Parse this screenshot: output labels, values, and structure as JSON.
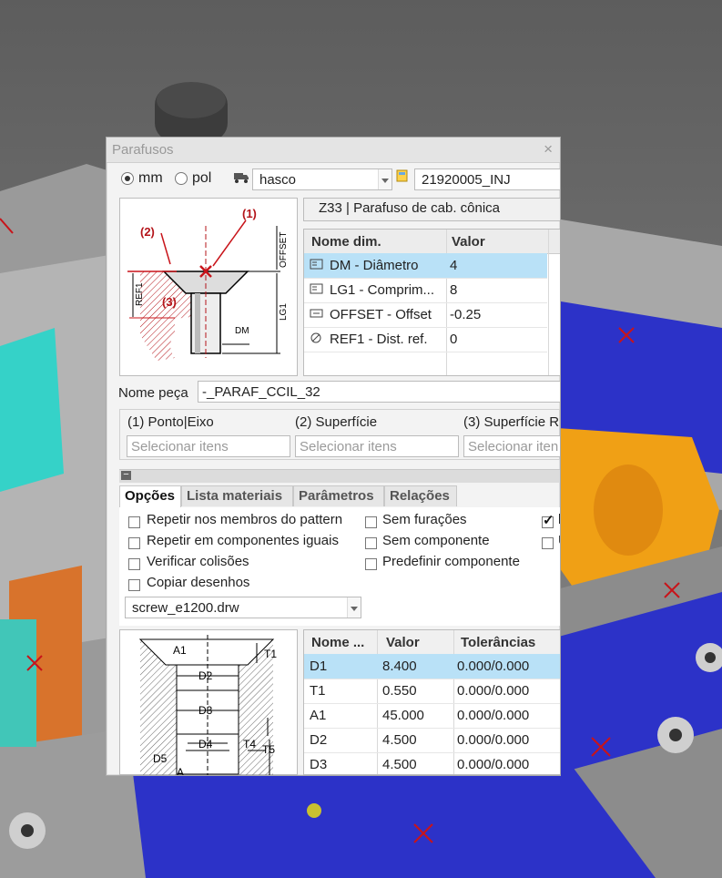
{
  "dialog": {
    "title": "Parafusos",
    "close_glyph": "×",
    "units": {
      "mm_label": "mm",
      "pol_label": "pol",
      "selected": "mm"
    },
    "supplier": {
      "value": "hasco",
      "icon": "truck-icon"
    },
    "catalog": {
      "value": "21920005_INJ",
      "icon": "catalog-icon"
    },
    "screw_type": "Z33 | Parafuso de cab. cônica",
    "top_diagram": {
      "labels": {
        "marker1": "(1)",
        "marker2": "(2)",
        "marker3": "(3)",
        "offset": "OFFSET",
        "ref1": "REF1",
        "lg1": "LG1",
        "dm": "DM"
      }
    },
    "dim_table": {
      "headers": [
        "Nome dim.",
        "Valor"
      ],
      "rows": [
        {
          "icon": "dimension-icon",
          "name": "DM - Diâmetro",
          "value": "4",
          "selected": true
        },
        {
          "icon": "dimension-icon",
          "name": "LG1 - Comprim...",
          "value": "8"
        },
        {
          "icon": "offset-icon",
          "name": "OFFSET - Offset",
          "value": "-0.25"
        },
        {
          "icon": "ref-null-icon",
          "name": "REF1 - Dist. ref.",
          "value": "0"
        }
      ]
    },
    "part_name": {
      "label": "Nome peça",
      "value": "-_PARAF_CCIL_32"
    },
    "references": [
      {
        "label": "(1) Ponto|Eixo",
        "placeholder": "Selecionar itens"
      },
      {
        "label": "(2) Superfície",
        "placeholder": "Selecionar itens"
      },
      {
        "label": "(3) Superfície R",
        "placeholder": "Selecionar iten"
      }
    ],
    "collapse_glyph": "−",
    "tabs": [
      "Opções",
      "Lista materiais",
      "Parâmetros",
      "Relações"
    ],
    "active_tab": "Opções",
    "options": {
      "col1": [
        {
          "label": "Repetir nos membros do pattern",
          "checked": false
        },
        {
          "label": "Repetir em componentes iguais",
          "checked": false
        },
        {
          "label": "Verificar colisões",
          "checked": false
        },
        {
          "label": "Copiar desenhos",
          "checked": false
        }
      ],
      "col2": [
        {
          "label": "Sem furações",
          "checked": false
        },
        {
          "label": "Sem componente",
          "checked": false
        },
        {
          "label": "Predefinir componente",
          "checked": false
        }
      ],
      "col3": [
        {
          "label": "l",
          "checked": true
        },
        {
          "label": "U",
          "checked": false
        }
      ]
    },
    "drawing": {
      "value": "screw_e1200.drw"
    },
    "bottom_diagram": {
      "labels": {
        "a1": "A1",
        "t1": "T1",
        "d2": "D2",
        "d3": "D3",
        "d4": "D4",
        "t4": "T4",
        "t5": "T5",
        "d5": "D5",
        "a": "A"
      }
    },
    "hole_table": {
      "headers": [
        "Nome ...",
        "Valor",
        "Tolerâncias"
      ],
      "rows": [
        {
          "name": "D1",
          "value": "8.400",
          "tol": "0.000/0.000",
          "selected": true
        },
        {
          "name": "T1",
          "value": "0.550",
          "tol": "0.000/0.000"
        },
        {
          "name": "A1",
          "value": "45.000",
          "tol": "0.000/0.000"
        },
        {
          "name": "D2",
          "value": "4.500",
          "tol": "0.000/0.000"
        },
        {
          "name": "D3",
          "value": "4.500",
          "tol": "0.000/0.000"
        }
      ]
    }
  },
  "colors": {
    "selection": "#b9e1f7",
    "arrow_red": "#b4141a",
    "cad_blue": "#2c32c8",
    "cad_orange": "#f0a015"
  }
}
